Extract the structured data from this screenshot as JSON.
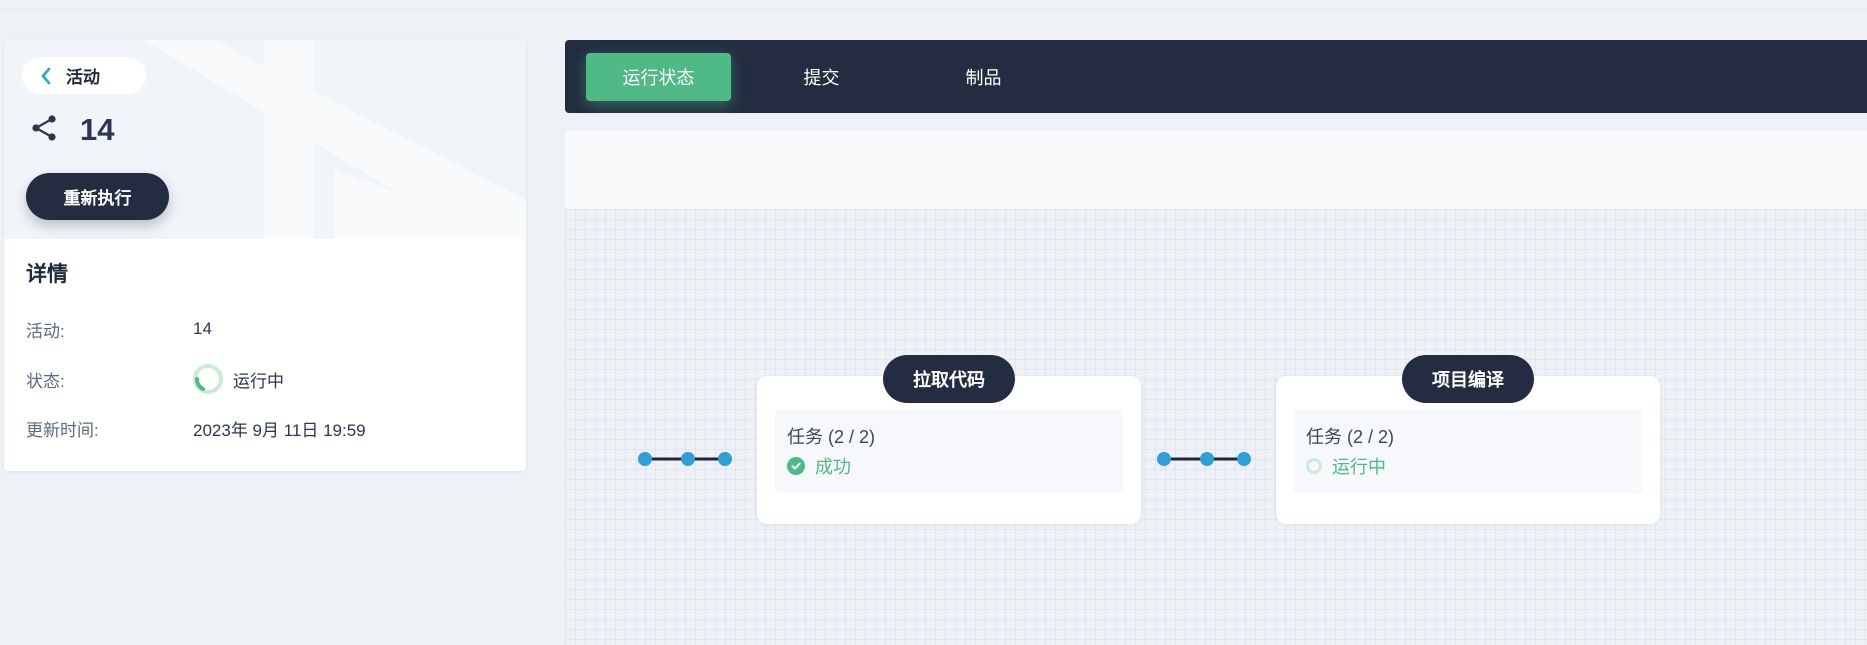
{
  "sidebar": {
    "back_label": "活动",
    "build_number": "14",
    "rerun_label": "重新执行",
    "details_title": "详情",
    "details": [
      {
        "key": "活动:",
        "value": "14"
      },
      {
        "key": "状态:",
        "value": "运行中",
        "icon": "running-spinner-icon"
      },
      {
        "key": "更新时间:",
        "value": "2023年 9月 11日 19:59"
      }
    ]
  },
  "tabs": [
    {
      "label": "运行状态",
      "active": true
    },
    {
      "label": "提交",
      "active": false
    },
    {
      "label": "制品",
      "active": false
    }
  ],
  "pipeline": {
    "stages": [
      {
        "name": "拉取代码",
        "job_title": "任务 (2 / 2)",
        "status": "成功",
        "status_icon": "success-check-icon"
      },
      {
        "name": "项目编译",
        "job_title": "任务 (2 / 2)",
        "status": "运行中",
        "status_icon": "running-spinner-icon"
      }
    ]
  },
  "colors": {
    "dark": "#232c40",
    "accent_green": "#4fba86",
    "node_blue": "#2e9fd7",
    "background": "#eef2f6"
  }
}
